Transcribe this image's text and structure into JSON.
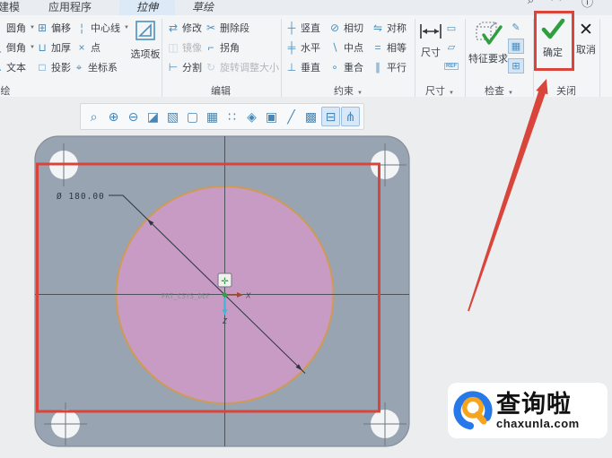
{
  "colors": {
    "annotation_red": "#d9453b",
    "plate_fill": "#98a4b1",
    "circle_fill": "#c79bc4",
    "circle_stroke": "#d09a55",
    "ok_check_green": "#2e9e3f",
    "ribbon_icon_blue": "#4e8fbe",
    "active_tab_bg": "#dce9f6"
  },
  "tab_bar": {
    "tabs": [
      {
        "label": "建模"
      },
      {
        "label": "应用程序"
      },
      {
        "label": "拉伸"
      },
      {
        "label": "草绘"
      }
    ],
    "corner_icons": [
      {
        "name": "search-icon",
        "glyph": "⌕"
      },
      {
        "name": "minimize-ribbon-icon",
        "glyph": "◠"
      },
      {
        "name": "info-icon",
        "glyph": "ⓘ"
      }
    ]
  },
  "ribbon": {
    "group_labels": [
      {
        "label": "绘",
        "caret": ""
      },
      {
        "label": "编辑",
        "caret": ""
      },
      {
        "label": "约束",
        "caret": "▼"
      },
      {
        "label": "尺寸",
        "caret": "▼"
      },
      {
        "label": "检查",
        "caret": "▼"
      },
      {
        "label": "关闭",
        "caret": ""
      }
    ],
    "sketching": {
      "items": [
        {
          "label": "圆角",
          "glyph": "◜",
          "caret": "▼"
        },
        {
          "label": "倒角",
          "glyph": "◺",
          "caret": "▼"
        },
        {
          "label": "文本",
          "glyph": "A",
          "caret": ""
        },
        {
          "label": "偏移",
          "glyph": "⊞",
          "caret": ""
        },
        {
          "label": "加厚",
          "glyph": "⊔",
          "caret": ""
        },
        {
          "label": "投影",
          "glyph": "□",
          "caret": ""
        },
        {
          "label": "中心线",
          "glyph": "¦",
          "caret": "▼"
        },
        {
          "label": "点",
          "glyph": "×",
          "caret": ""
        },
        {
          "label": "坐标系",
          "glyph": "⌖",
          "caret": ""
        },
        {
          "label": "选项板"
        }
      ]
    },
    "editing": {
      "items": [
        {
          "label": "修改",
          "glyph": "⇄"
        },
        {
          "label": "删除段",
          "glyph": "✂"
        },
        {
          "label": "镜像",
          "glyph": "◫"
        },
        {
          "label": "拐角",
          "glyph": "⌐"
        },
        {
          "label": "分割",
          "glyph": "⊢"
        },
        {
          "label": "旋转调整大小",
          "glyph": "↻"
        }
      ]
    },
    "constrain": {
      "items": [
        {
          "label": "竖直",
          "glyph": "┼"
        },
        {
          "label": "相切",
          "glyph": "⊘"
        },
        {
          "label": "对称",
          "glyph": "⇋"
        },
        {
          "label": "水平",
          "glyph": "╪"
        },
        {
          "label": "中点",
          "glyph": "∖"
        },
        {
          "label": "相等",
          "glyph": "="
        },
        {
          "label": "垂直",
          "glyph": "⊥"
        },
        {
          "label": "重合",
          "glyph": "∘"
        },
        {
          "label": "平行",
          "glyph": "∥"
        }
      ]
    },
    "dimension": {
      "big": {
        "label": "尺寸"
      },
      "minis": [
        {
          "name": "perimeter-dimension-icon",
          "glyph": "▭"
        },
        {
          "name": "baseline-dimension-icon",
          "glyph": "▱"
        },
        {
          "name": "reference-dimension-icon",
          "glyph": "REF"
        }
      ]
    },
    "inspect": {
      "big": {
        "label": "特征要求"
      },
      "minis": [
        {
          "name": "overlapping-geometry-icon",
          "glyph": "✎"
        },
        {
          "name": "shade-closed-loops-icon",
          "glyph": "▦"
        },
        {
          "name": "highlight-open-ends-icon",
          "glyph": "⊞"
        }
      ]
    },
    "close": {
      "ok": {
        "label": "确定"
      },
      "cancel": {
        "label": "取消",
        "glyph": "✕"
      }
    }
  },
  "view_toolbar": {
    "icons": [
      {
        "name": "refit-icon",
        "glyph": "⌕"
      },
      {
        "name": "zoom-in-icon",
        "glyph": "⊕"
      },
      {
        "name": "zoom-out-icon",
        "glyph": "⊖"
      },
      {
        "name": "repaint-icon",
        "glyph": "◪"
      },
      {
        "name": "display-style-icon",
        "glyph": "▧"
      },
      {
        "name": "no-hidden-icon",
        "glyph": "▢"
      },
      {
        "name": "capture-icon",
        "glyph": "▦"
      },
      {
        "name": "datum-display-icon",
        "glyph": "∷"
      },
      {
        "name": "spin-center-icon",
        "glyph": "◈"
      },
      {
        "name": "plane-display-icon",
        "glyph": "▣"
      },
      {
        "name": "axis-display-icon",
        "glyph": "╱"
      },
      {
        "name": "point-display-icon",
        "glyph": "▩"
      },
      {
        "name": "sketch-view-icon",
        "glyph": "⊟"
      },
      {
        "name": "sketcher-display-icon",
        "glyph": "⋔"
      }
    ]
  },
  "canvas": {
    "dimension_label": "Ø 180.00",
    "csys_label": "PRT_CSYS_DEF",
    "axis_x_label": "X",
    "axis_z_label": "Z"
  },
  "watermark": {
    "brand": "查询啦",
    "domain": "chaxunla.com"
  }
}
